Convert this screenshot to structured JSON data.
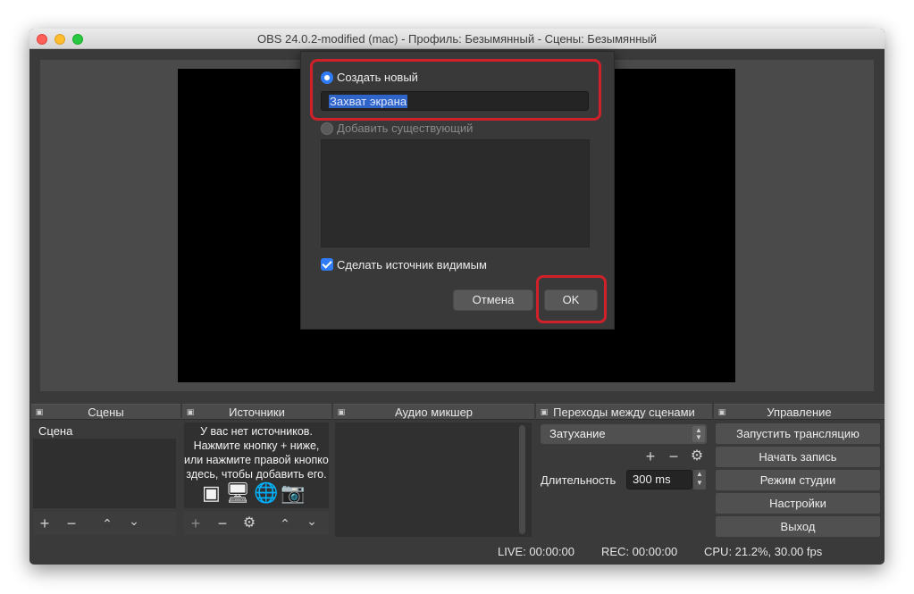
{
  "window": {
    "title": "OBS 24.0.2-modified (mac) - Профиль: Безымянный - Сцены: Безымянный"
  },
  "dialog": {
    "create_new_label": "Создать новый",
    "name_value": "Захват экрана",
    "add_existing_label": "Добавить существующий",
    "make_visible_label": "Сделать источник видимым",
    "cancel_label": "Отмена",
    "ok_label": "OK"
  },
  "docks": {
    "scenes": {
      "title": "Сцены",
      "items": [
        "Сцена"
      ]
    },
    "sources": {
      "title": "Источники",
      "empty_lines": [
        "У вас нет источников.",
        "Нажмите кнопку + ниже,",
        "или нажмите правой кнопкой",
        "здесь, чтобы добавить его."
      ]
    },
    "audio": {
      "title": "Аудио микшер"
    },
    "transitions": {
      "title": "Переходы между сценами",
      "selected": "Затухание",
      "duration_label": "Длительность",
      "duration_value": "300 ms"
    },
    "controls": {
      "title": "Управление",
      "buttons": [
        "Запустить трансляцию",
        "Начать запись",
        "Режим студии",
        "Настройки",
        "Выход"
      ]
    }
  },
  "status": {
    "live": "LIVE: 00:00:00",
    "rec": "REC: 00:00:00",
    "cpu": "CPU: 21.2%, 30.00 fps"
  },
  "colors": {
    "accent": "#2f7cf6",
    "highlight_box": "#d0212b"
  }
}
